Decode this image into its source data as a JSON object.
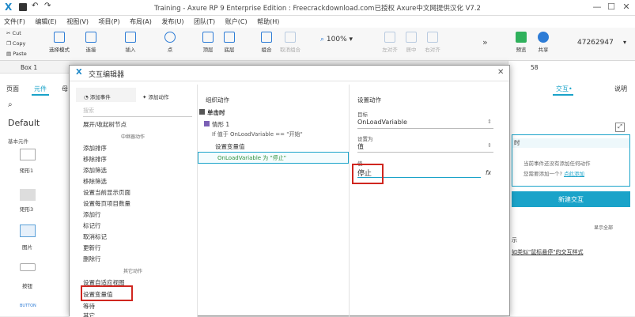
{
  "app": {
    "title": "Training - Axure RP 9 Enterprise Edition : Freecrackdownload.com已授权 Axure中文网提供汉化 V7.2",
    "logo": "X"
  },
  "window": {
    "minimize": "—",
    "maximize": "☐",
    "close": "✕"
  },
  "menu": [
    "文件(F)",
    "编辑(E)",
    "视图(V)",
    "项目(P)",
    "布局(A)",
    "发布(U)",
    "团队(T)",
    "账户(C)",
    "帮助(H)"
  ],
  "toolbar": {
    "cut": "Cut",
    "copy": "Copy",
    "paste": "Paste",
    "select_mode": "选择模式",
    "connect": "连接",
    "insert": "插入",
    "point": "点",
    "top": "顶层",
    "bottom": "底层",
    "group": "组合",
    "ungroup": "取消组合",
    "zoom": "100%",
    "left": "左对齐",
    "center": "居中",
    "right": "右对齐",
    "preview": "预览",
    "share": "共享",
    "account": "47262947",
    "more": "»"
  },
  "leftpane": {
    "tabs": [
      "页面",
      "元件",
      "母"
    ],
    "library": "Default",
    "subsection": "基本元件",
    "widgets": [
      "矩形1",
      "矩形3",
      "图片",
      "按钮"
    ],
    "button_sample": "BUTTON",
    "box_label": "Box 1"
  },
  "rightpane": {
    "tab_interaction": "交互•",
    "tab_notes": "说明",
    "x": "58",
    "y": "",
    "section_title": "时",
    "empty1": "当前事件还没有添加任何动作",
    "empty2": "您需要添加一个?",
    "add_link": "点此添加",
    "new_interaction": "新建交互",
    "show_all": "显示全部",
    "hint_tail": "示",
    "hint_link": "如类似\"鼠标悬停\"的交互样式"
  },
  "dialog": {
    "title": "交互编辑器",
    "close": "✕",
    "tab_add_event": "添加事件",
    "tab_add_action": "添加动作",
    "search_placeholder": "搜索",
    "actions_top": "展开/收起树节点",
    "section_repeater": "中继器动作",
    "repeater_actions": [
      "添加排序",
      "移除排序",
      "添加筛选",
      "移除筛选",
      "设置当前显示页面",
      "设置每页项目数量",
      "添加行",
      "标记行",
      "取消标记",
      "更新行",
      "删除行"
    ],
    "section_other": "其它动作",
    "other_actions": [
      "设置自适应视图",
      "设置变量值",
      "等待",
      "其它"
    ],
    "col2_header": "组织动作",
    "event": "单击时",
    "case": "情形 1",
    "condition": "If 值于 OnLoadVariable == \"开始\"",
    "action": "设置变量值",
    "action_detail": "OnLoadVariable 为 \"停止\"",
    "col3_header": "设置动作",
    "target_label": "目标",
    "target_value": "OnLoadVariable",
    "setas_label": "设置为",
    "setas_value": "值",
    "value_label": "值",
    "value": "停止",
    "fx": "fx"
  },
  "colors": {
    "accent": "#1aa3c9",
    "red": "#d0261f",
    "brand_blue": "#2e7cd6"
  }
}
